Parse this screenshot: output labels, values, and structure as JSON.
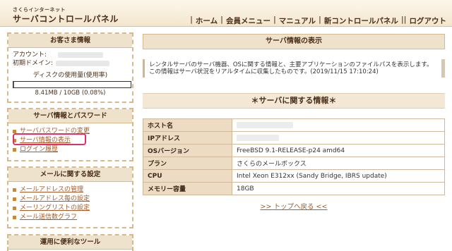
{
  "header": {
    "brand_top": "さくらインターネット",
    "brand_main": "サーバコントロールパネル",
    "nav": [
      "ホーム",
      "会員メニュー",
      "マニュアル",
      "新コントロールパネル",
      "ログアウト"
    ]
  },
  "customer": {
    "title": "お客さま情報",
    "account_label": "アカウント:",
    "domain_label": "初期ドメイン:",
    "disk_label": "ディスクの使用量(使用率)",
    "disk_value": "8.41MB / 10GB (0.08%)",
    "disk_fraction": 0.0008
  },
  "server_menu": {
    "title": "サーバ情報とパスワード",
    "items": [
      "サーバパスワードの変更",
      "サーバ情報の表示",
      "ログイン履歴"
    ]
  },
  "mail_menu": {
    "title": "メールに関する設定",
    "items": [
      "メールアドレスの管理",
      "メールアドレス毎の設定",
      "メーリングリストの設定",
      "メール送信数グラフ"
    ]
  },
  "tools_menu": {
    "title": "運用に便利なツール"
  },
  "main": {
    "title": "サーバ情報の表示",
    "notice_line1": "レンタルサーバのサーバ機器、OSに関する情報と、主要アプリケーションのファイルパスを表示します。",
    "notice_line2": "この情報はサーバ状況をリアルタイムに収集したものです。(2019/11/15 17:10:24)",
    "section_title": "＊サーバに関する情報＊",
    "rows": [
      {
        "key": "ホスト名",
        "value": ""
      },
      {
        "key": "IPアドレス",
        "value": ""
      },
      {
        "key": "OSバージョン",
        "value": "FreeBSD 9.1-RELEASE-p24 amd64"
      },
      {
        "key": "プラン",
        "value": "さくらのメールボックス"
      },
      {
        "key": "CPU",
        "value": "Intel Xeon E312xx (Sandy Bridge, IBRS update)"
      },
      {
        "key": "メモリー容量",
        "value": "18GB"
      }
    ],
    "back_link": ">> トップへ戻る <<"
  }
}
